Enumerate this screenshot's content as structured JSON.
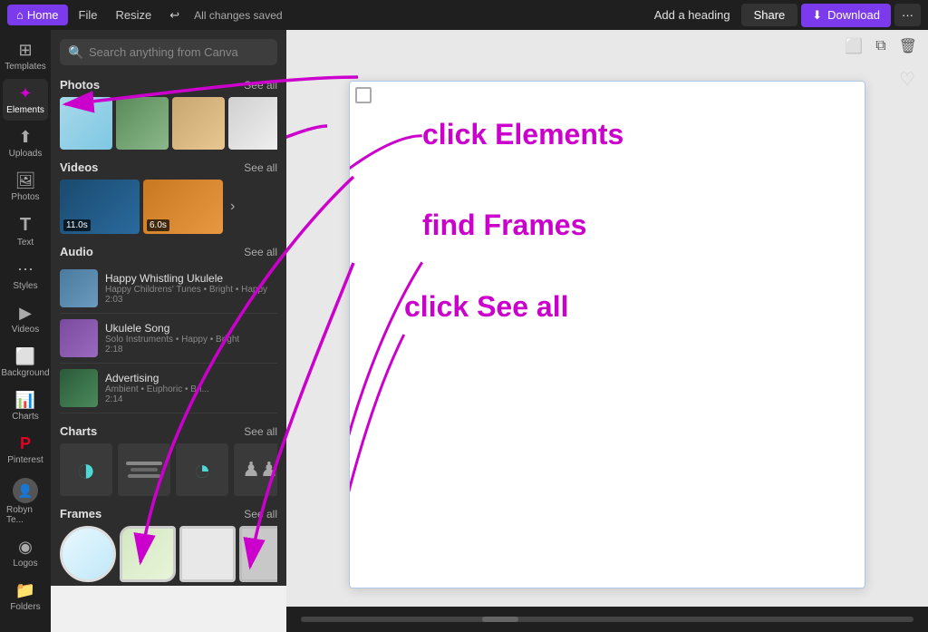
{
  "topnav": {
    "home_label": "Home",
    "file_label": "File",
    "resize_label": "Resize",
    "undo_label": "↩",
    "saved_label": "All changes saved",
    "add_heading_label": "Add a heading",
    "share_label": "Share",
    "download_label": "Download",
    "more_label": "···"
  },
  "sidebar": {
    "items": [
      {
        "id": "templates",
        "icon": "⊞",
        "label": "Templates"
      },
      {
        "id": "elements",
        "icon": "✦",
        "label": "Elements"
      },
      {
        "id": "uploads",
        "icon": "↑",
        "label": "Uploads"
      },
      {
        "id": "photos",
        "icon": "🖼",
        "label": "Photos"
      },
      {
        "id": "text",
        "icon": "T",
        "label": "Text"
      },
      {
        "id": "styles",
        "icon": "🎨",
        "label": "Styles"
      },
      {
        "id": "videos",
        "icon": "▶",
        "label": "Videos"
      },
      {
        "id": "background",
        "icon": "⬜",
        "label": "Background"
      },
      {
        "id": "charts",
        "icon": "📊",
        "label": "Charts"
      },
      {
        "id": "pinterest",
        "icon": "P",
        "label": "Pinterest"
      },
      {
        "id": "robyn",
        "icon": "👤",
        "label": "Robyn Te..."
      },
      {
        "id": "logos",
        "icon": "◉",
        "label": "Logos"
      },
      {
        "id": "folders",
        "icon": "📁",
        "label": "Folders"
      }
    ]
  },
  "panel": {
    "search_placeholder": "Search anything from Canva",
    "sections": [
      {
        "id": "photos",
        "title": "Photos",
        "see_all": "See all",
        "items": [
          {
            "id": "p1",
            "color_class": "p1"
          },
          {
            "id": "p2",
            "color_class": "p2"
          },
          {
            "id": "p3",
            "color_class": "p3"
          },
          {
            "id": "p4",
            "color_class": "p4"
          }
        ]
      },
      {
        "id": "videos",
        "title": "Videos",
        "see_all": "See all",
        "items": [
          {
            "id": "v1",
            "color_class": "v1",
            "duration": "11.0s"
          },
          {
            "id": "v2",
            "color_class": "v2",
            "duration": "6.0s"
          }
        ]
      },
      {
        "id": "audio",
        "title": "Audio",
        "see_all": "See all",
        "items": [
          {
            "id": "a1",
            "color_class": "a1",
            "title": "Happy Whistling Ukulele",
            "meta": "Happy Childrens' Tunes • Bright • Happy",
            "duration": "2:03"
          },
          {
            "id": "a2",
            "color_class": "a2",
            "title": "Ukulele Song",
            "meta": "Solo Instruments • Happy • Bright",
            "duration": "2:18"
          },
          {
            "id": "a3",
            "color_class": "a3",
            "title": "Advertising",
            "meta": "Ambient • Euphoric • Bri...",
            "duration": "2:14"
          }
        ]
      },
      {
        "id": "charts",
        "title": "Charts",
        "see_all": "See all",
        "items": [
          {
            "id": "c1",
            "symbol": "◑",
            "class": "chart1"
          },
          {
            "id": "c2",
            "symbol": "—",
            "class": "chart2"
          },
          {
            "id": "c3",
            "symbol": "◔",
            "class": "chart3"
          },
          {
            "id": "c4",
            "symbol": "♟♟",
            "class": "chart4"
          }
        ]
      },
      {
        "id": "frames",
        "title": "Frames",
        "see_all": "See all",
        "items": [
          {
            "id": "f1",
            "color_class": "fr1"
          },
          {
            "id": "f2",
            "color_class": "fr2"
          },
          {
            "id": "f3",
            "color_class": "fr3"
          },
          {
            "id": "f4",
            "color_class": "fr4"
          }
        ]
      }
    ]
  },
  "canvas": {
    "heart_icon": "♡"
  },
  "annotations": {
    "line1": "click Elements",
    "line2": "find Frames",
    "line3": "click See all"
  }
}
